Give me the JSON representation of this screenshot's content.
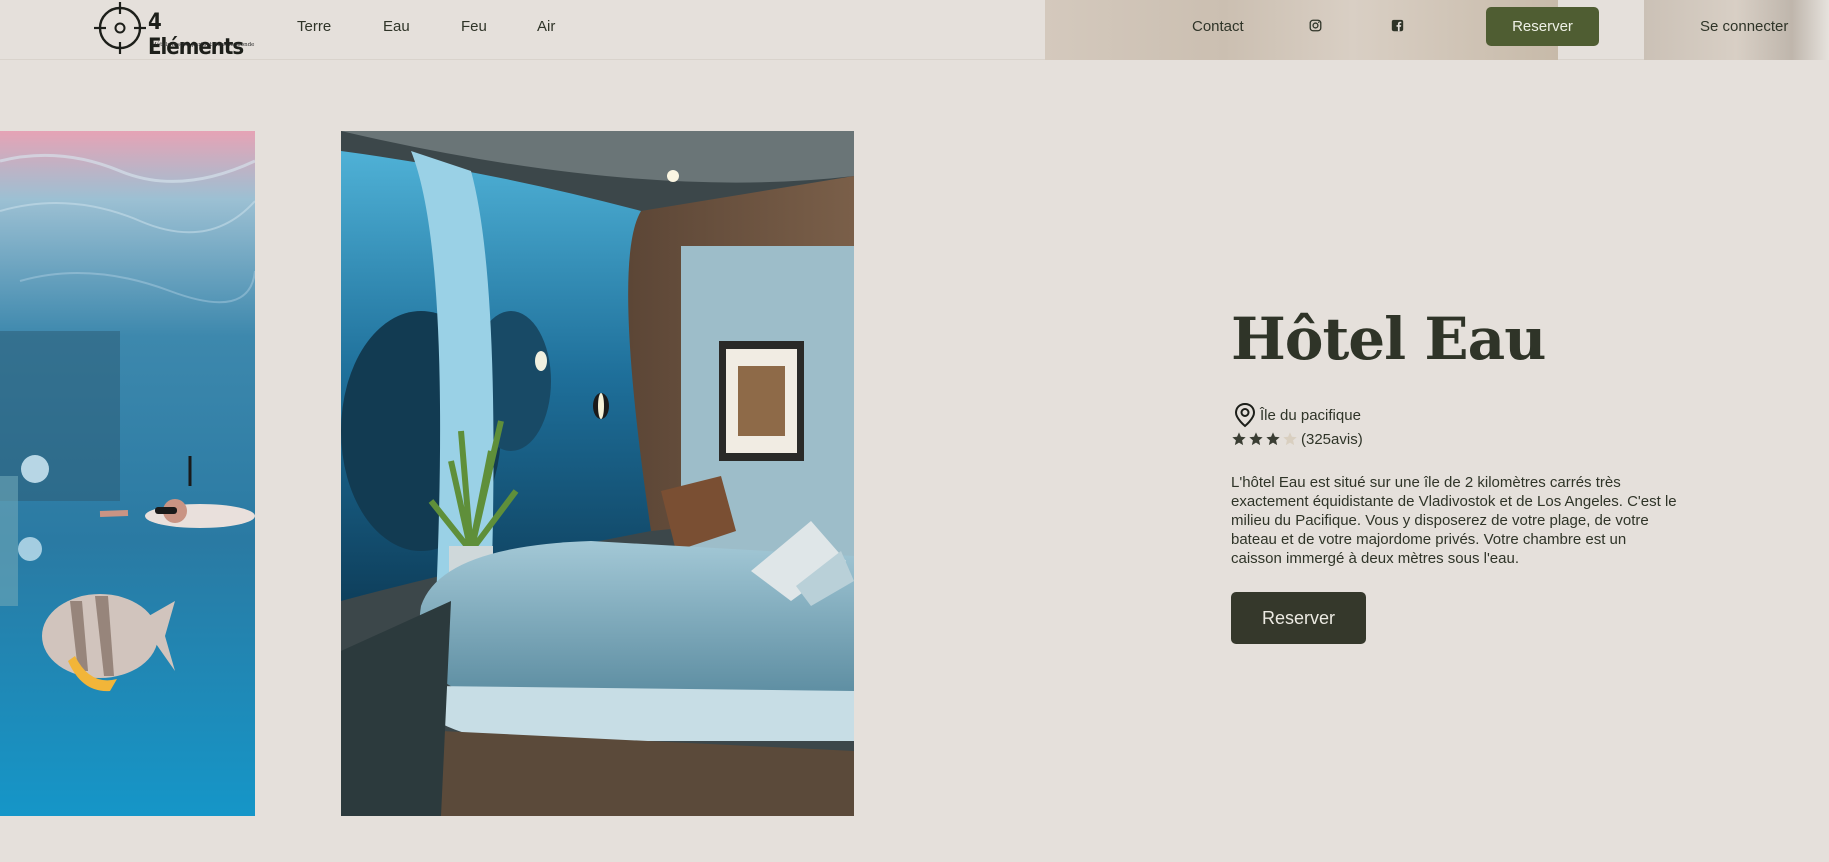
{
  "header": {
    "logo": {
      "title": "4 Eléments",
      "tagline": "Hôtels insolis partout dans le monde"
    },
    "nav": [
      "Terre",
      "Eau",
      "Feu",
      "Air"
    ],
    "contact_label": "Contact",
    "social_icons": [
      "instagram-icon",
      "facebook-icon"
    ],
    "reserve_label": "Reserver",
    "login_label": "Se connecter"
  },
  "gallery": {
    "images": [
      "underwater-snorkeler-photo",
      "underwater-hotel-room-photo"
    ]
  },
  "hotel": {
    "title": "Hôtel Eau",
    "location": "Île du pacifique",
    "rating": 3,
    "rating_max": 4,
    "reviews": "(325avis)",
    "description": "L'hôtel Eau est situé sur une île de 2 kilomètres carrés très exactement équidistante de Vladivostok et de Los Angeles. C'est le milieu du Pacifique. Vous y disposerez de votre plage, de votre bateau et de votre majordome privés. Votre chambre est un caisson immergé à deux mètres sous l'eau.",
    "reserve_label": "Reserver"
  },
  "colors": {
    "background": "#e5e0db",
    "text": "#2f3428",
    "header_button": "#4f5d32",
    "main_button": "#35382b",
    "star_filled": "#3a3d33",
    "star_empty": "#d9cfc0"
  }
}
